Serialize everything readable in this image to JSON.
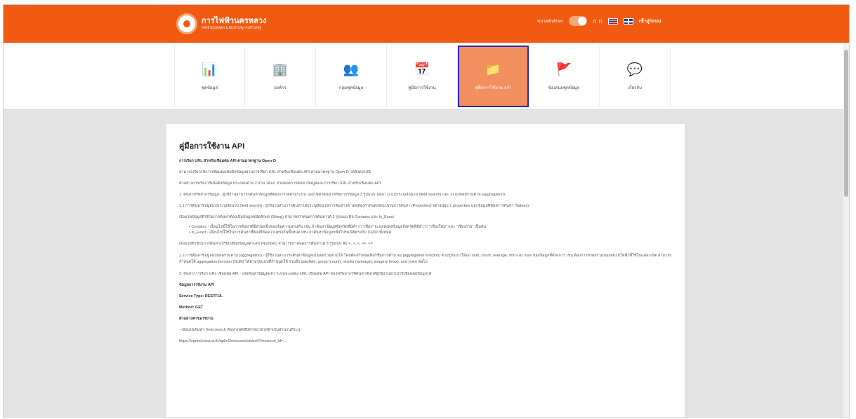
{
  "header": {
    "logo_title": "การไฟฟ้านครหลวง",
    "logo_sub": "Metropolitan Electricity Authority",
    "font_size_label": "ขนาดตัวอักษร",
    "contrast_label": "ก ก",
    "login_label": "เข้าสู่ระบบ",
    "accent_color": "#f25a12"
  },
  "nav": {
    "items": [
      {
        "label": "ชุดข้อมูล",
        "icon": "📊"
      },
      {
        "label": "องค์กร",
        "icon": "🏢"
      },
      {
        "label": "กลุ่มชุดข้อมูล",
        "icon": "👥"
      },
      {
        "label": "คู่มือการใช้งาน",
        "icon": "📅"
      },
      {
        "label": "คู่มือการใช้งาน API",
        "icon": "📁"
      },
      {
        "label": "ข้อเสนอชุดข้อมูล",
        "icon": "🚩"
      },
      {
        "label": "เกี่ยวกับ",
        "icon": "💬"
      }
    ],
    "active_index": 4
  },
  "content": {
    "title": "คู่มือการใช้งาน API",
    "lines": [
      "การเรียก URL สำหรับเชื่อมต่อ API ตามมาตรฐาน Open-D",
      "สามารถเรียกใช้การเชื่อมต่อเพื่อดึงข้อมูลผ่านการเรียก URL สำหรับเชื่อมต่อ API ตามมาตรฐาน Open-D ได้ดังต่อไปนี้",
      "ตัวอย่างการเรียกใช้เพื่อดึงข้อมูล ประกอบด้วย 2 ส่วน ได้แก่ ส่วนของการค้นหาข้อมูลและการเรียก URL สำหรับเชื่อมต่อ API",
      "1. ค้นหาทรัพยากรข้อมูล - ผู้ใช้งานสามารถค้นหาข้อมูลที่ต้องการได้ผ่านระบบ โดยใช้คำค้นหาทรัพยากรข้อมูล 3 รูปแบบ ได้แก่ 1) แบบระบุเงื่อนไข (field search) และ 2) แบบผลรวมตาม (aggregation)",
      "1.1 การค้นหาข้อมูลแบบระบุเงื่อนไข (field search) - ผู้ใช้งานสามารถค้นหาโดยระบุเงื่อนไขการค้นหาได้ โดยต้องกำหนดเงื่อนไขในการค้นหา (Properties) อย่างน้อย 1 properties และข้อมูลที่ต้องการค้นหา (Values)",
      "เงื่อนไขข้อมูลที่ใช้ในการค้นหาต้องเป็นข้อมูลชนิดอักษร (String) สามารถกำหนดการค้นหาได้ 2 รูปแบบ คือ Contains และ Is_Exact"
    ],
    "bullets": [
      "• Contains - เงื่อนไขนี้ใช้ในการค้นหาที่มีส่วนหนึ่งของข้อความตรงกัน เช่น ถ้าค้นหาข้อมูลจังหวัดที่มีคำว่า \"เชียง\" จะแสดงผลข้อมูลจังหวัดที่มีคำว่า \"เชียงใหม่\" และ \"เชียงราย\" เป็นต้น",
      "• Is_Exact - เงื่อนไขนี้ใช้ในการค้นหาที่ต้องมีข้อความตรงกันทั้งหมด เช่น ถ้าค้นหาข้อมูลรหัสไปรษณีย์ตรงกับ 10200 ทั้งหมด"
    ],
    "lines2": [
      "เงื่อนไขที่ใช้ในการค้นหาเปรียบเทียบข้อมูลตัวเลข (Number) สามารถกำหนดการค้นหาได้ 5 รูปแบบ คือ =, >, <, >=, <="
    ],
    "para": "1.2 การค้นหาข้อมูลแบบผลรวมตาม (aggregation) - ผู้ใช้งานสามารถค้นหาข้อมูลแบบผลรวมตามได้ โดยต้องกำหนดฟังก์ชันการคำนวณ (aggregation function) ตามรูปแบบ ได้แก่ sum, count, average, min และ max ของข้อมูลที่ต้องการ เช่น ต้องการหาผลรวมของหน่วยไฟฟ้าที่ใช้ในแต่ละเขต สามารถกำหนดให้ aggregation function (SUM) ได้ตามรูปแบบที่กำหนดให้ รวมถึง datefield, group (count), results (average), imagery (max), and (min) ต่อไป",
    "lines3": [
      "2. ค้นหาการเรียก URL เชื่อมต่อ API - เมื่อค้นหาข้อมูลแล้ว ระบบจะแสดง URL เชื่อมต่อ API ของทรัพยากรที่ค้นหาเพื่อให้ผู้ใช้งานนำไปใช้เชื่อมต่อข้อมูลได้"
    ],
    "details": [
      {
        "text": "ข้อมูลการใช้งาน API",
        "bold": true
      },
      {
        "text": "Service Type: RESTFUL",
        "bold": true
      },
      {
        "text": "Method: GET",
        "bold": true
      },
      {
        "text": "ตัวอย่างคำขอใช้งาน",
        "bold": true
      },
      {
        "text": "- เงื่อนไขค้นหา: field search ค้นหาเขตที่มีค่าหน่วยไฟฟ้าเป็นจำนวนที่ระบุ",
        "bold": false
      },
      {
        "text": "https://opend.mea.or.th/api/v1/resource/search?resource_id=...",
        "bold": false
      }
    ]
  }
}
